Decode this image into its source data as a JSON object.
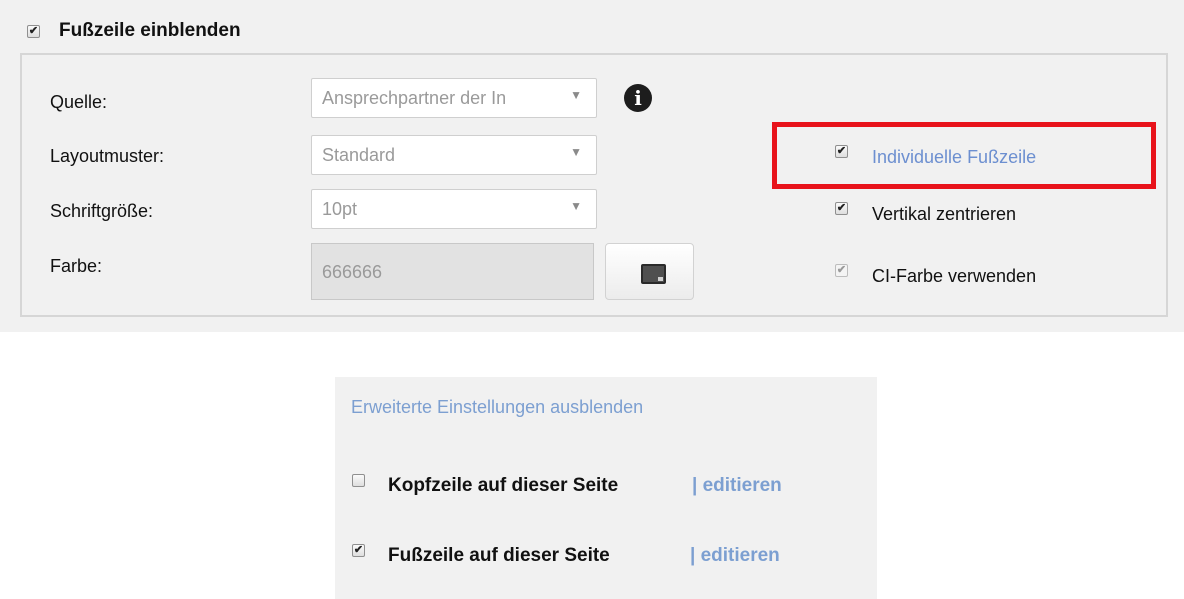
{
  "footer_section": {
    "toggle_label": "Fußzeile einblenden",
    "toggle_checked": true,
    "fields": {
      "source": {
        "label": "Quelle:",
        "value": "Ansprechpartner der In"
      },
      "layout": {
        "label": "Layoutmuster:",
        "value": "Standard"
      },
      "font_size": {
        "label": "Schriftgröße:",
        "value": "10pt"
      },
      "color": {
        "label": "Farbe:",
        "value": "666666"
      }
    },
    "options": {
      "individual_footer": {
        "label": "Individuelle Fußzeile",
        "checked": true
      },
      "vertical_center": {
        "label": "Vertikal zentrieren",
        "checked": true
      },
      "ci_color": {
        "label": "CI-Farbe verwenden",
        "checked": true,
        "disabled": true
      }
    },
    "info_icon": "info-icon",
    "highlight_color": "#e8131b"
  },
  "advanced": {
    "hide_link": "Erweiterte Einstellungen ausblenden",
    "header_page": {
      "label": "Kopfzeile auf dieser Seite",
      "edit": "| editieren",
      "checked": false
    },
    "footer_page": {
      "label": "Fußzeile auf dieser Seite",
      "edit": "| editieren",
      "checked": true
    }
  },
  "colors": {
    "link": "#7c9fd1",
    "panel_bg": "#f1f1f1",
    "highlight": "#e8131b"
  }
}
